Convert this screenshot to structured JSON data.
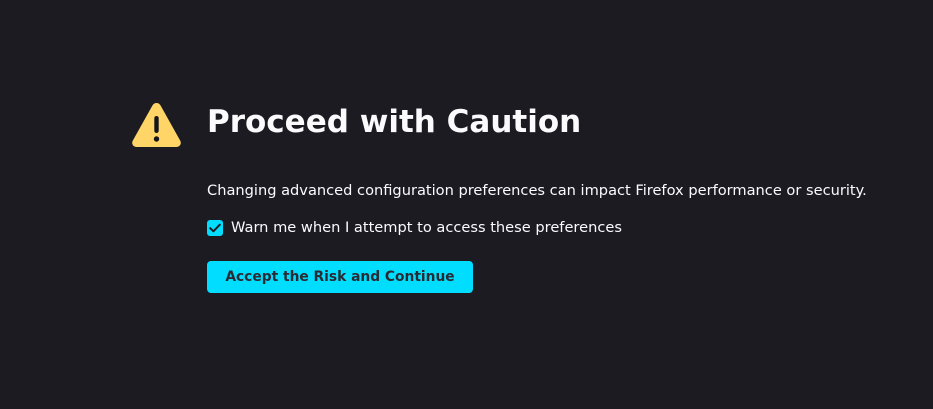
{
  "warning": {
    "icon": "warning-triangle-icon",
    "icon_color": "#ffd567"
  },
  "title": "Proceed with Caution",
  "description": "Changing advanced configuration preferences can impact Firefox performance or security.",
  "warn_checkbox": {
    "checked": true,
    "icon": "checkmark-icon",
    "label": "Warn me when I attempt to access these preferences"
  },
  "accept_button": {
    "label": "Accept the Risk and Continue"
  },
  "colors": {
    "background": "#1c1b22",
    "accent": "#00ddff",
    "text": "#fbfbfe",
    "button_text": "#2b2a33"
  }
}
